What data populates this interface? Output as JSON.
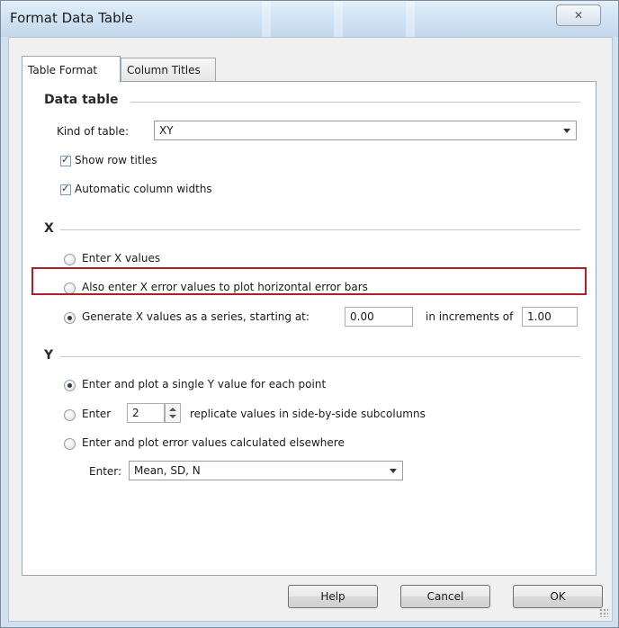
{
  "window": {
    "title": "Format Data Table",
    "close_symbol": "✕"
  },
  "tabs": [
    {
      "label": "Table Format",
      "active": true
    },
    {
      "label": "Column Titles",
      "active": false
    }
  ],
  "data_table": {
    "heading": "Data table",
    "kind_label": "Kind of table:",
    "kind_value": "XY",
    "show_row_titles": {
      "label": "Show row titles",
      "checked": true
    },
    "auto_widths": {
      "label": "Automatic column widths",
      "checked": true
    }
  },
  "x_section": {
    "heading": "X",
    "options": [
      {
        "label": "Enter X values",
        "selected": false
      },
      {
        "label": "Also enter X error values to plot horizontal error bars",
        "selected": false
      },
      {
        "label": "Generate X values as a series, starting at:",
        "selected": true
      }
    ],
    "start_value": "0.00",
    "increment_label": "in increments of",
    "increment_value": "1.00"
  },
  "y_section": {
    "heading": "Y",
    "option_single": "Enter and plot a single Y value for each point",
    "option_replicate_prefix": "Enter",
    "replicate_count": "2",
    "option_replicate_suffix": "replicate values in side-by-side subcolumns",
    "option_error": "Enter and plot error values calculated elsewhere",
    "enter_label": "Enter:",
    "enter_value": "Mean, SD, N",
    "selected_option": "single"
  },
  "buttons": {
    "help": "Help",
    "cancel": "Cancel",
    "ok": "OK"
  },
  "accent": {
    "highlight_border": "#b21e22"
  }
}
